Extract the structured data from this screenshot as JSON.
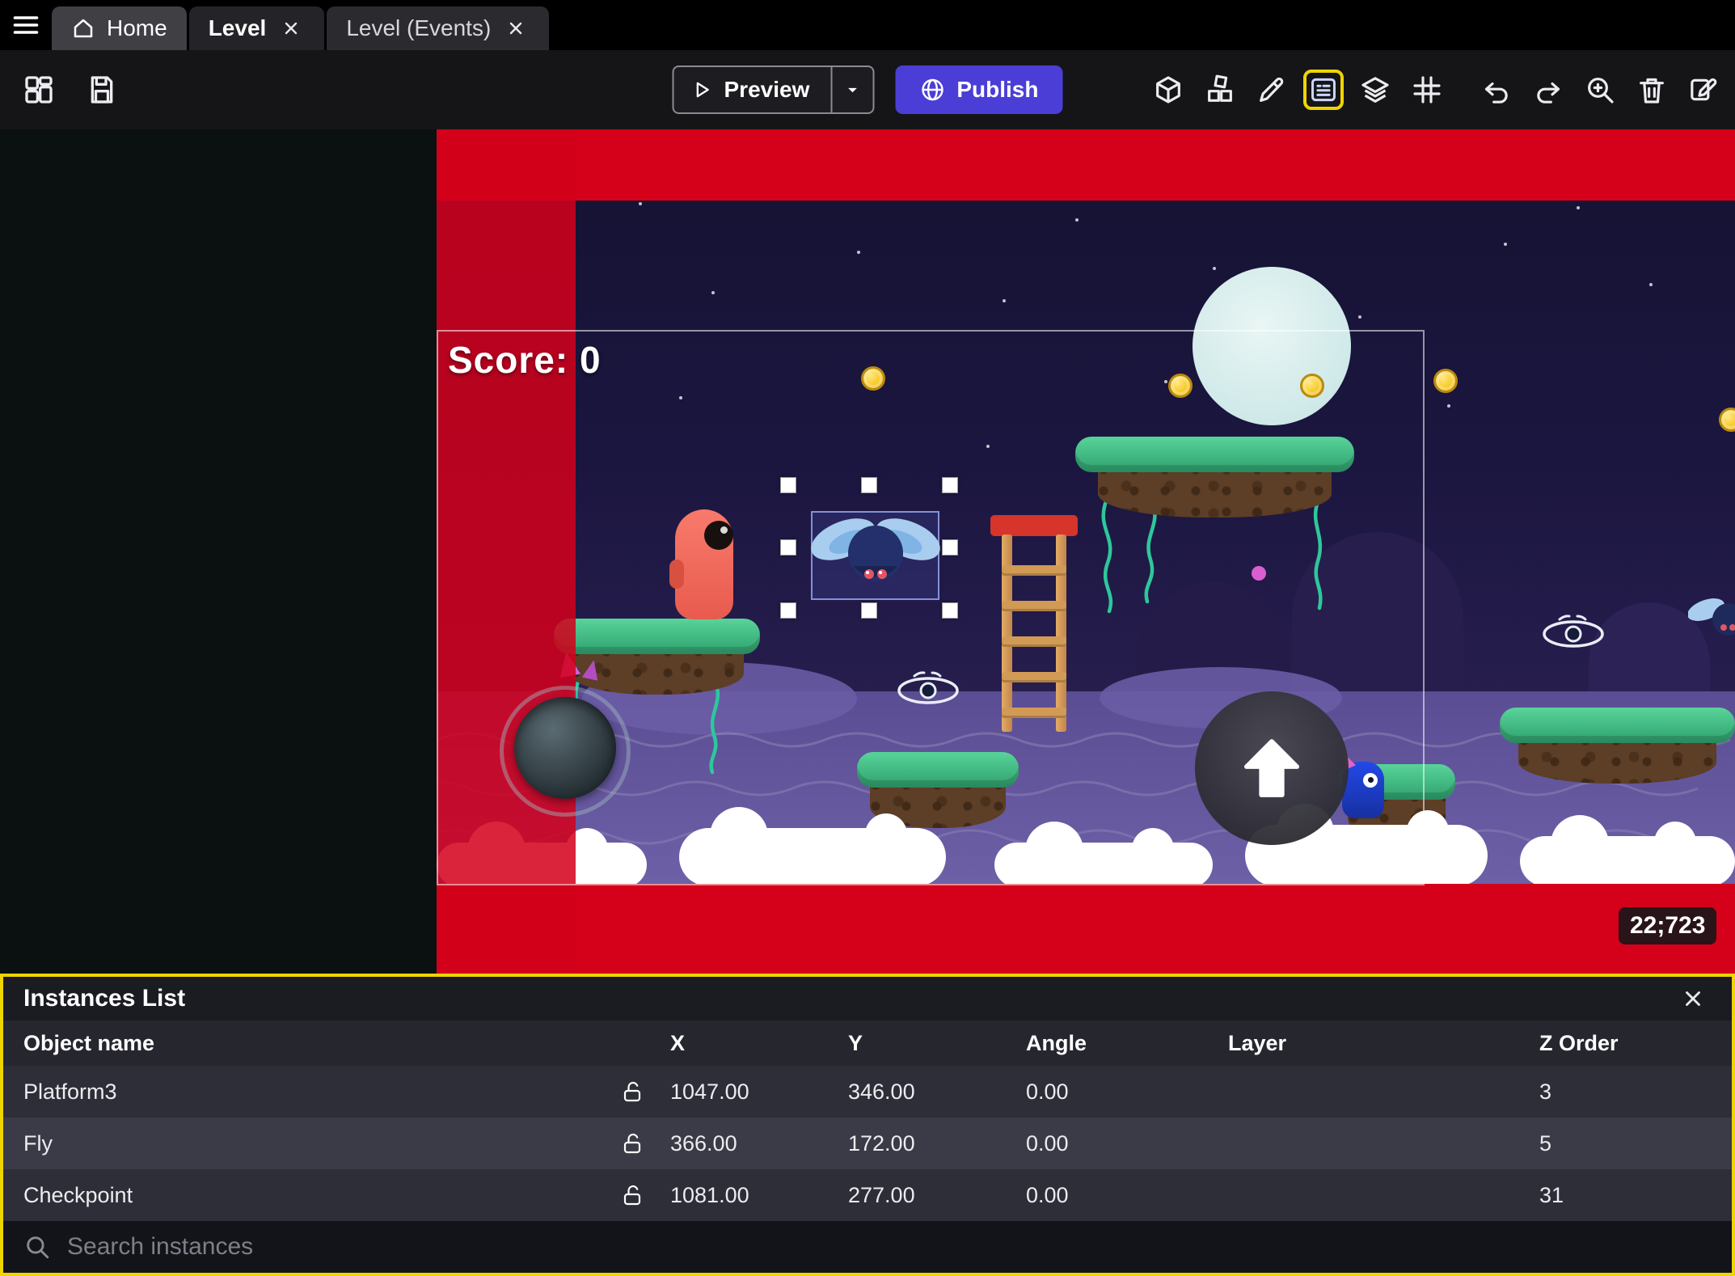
{
  "tabs": {
    "home": "Home",
    "level": "Level",
    "level_events": "Level (Events)"
  },
  "toolbar": {
    "preview": "Preview",
    "publish": "Publish",
    "right_icons": [
      "cube-3d-icon",
      "objects-icon",
      "pencil-icon",
      "instances-list-icon",
      "layers-icon",
      "grid-icon",
      "undo-icon",
      "redo-icon",
      "zoom-in-icon",
      "trash-icon",
      "rename-icon"
    ],
    "left_icons": [
      "project-manager-icon",
      "save-icon"
    ]
  },
  "scene": {
    "score": "Score: 0",
    "coords": "22;723"
  },
  "panel": {
    "title": "Instances List",
    "columns": {
      "name": "Object name",
      "x": "X",
      "y": "Y",
      "angle": "Angle",
      "layer": "Layer",
      "z": "Z Order"
    },
    "rows": [
      {
        "name": "Platform3",
        "x": "1047.00",
        "y": "346.00",
        "angle": "0.00",
        "layer": "",
        "z": "3"
      },
      {
        "name": "Fly",
        "x": "366.00",
        "y": "172.00",
        "angle": "0.00",
        "layer": "",
        "z": "5"
      },
      {
        "name": "Checkpoint",
        "x": "1081.00",
        "y": "277.00",
        "angle": "0.00",
        "layer": "",
        "z": "31"
      }
    ],
    "search_placeholder": "Search instances"
  },
  "colors": {
    "publish_purple": "#4b3ed6",
    "highlight_yellow": "#f0d400",
    "overlay_red": "#d50019",
    "grass_green": "#3fbf8f",
    "sky_dark": "#141231"
  }
}
